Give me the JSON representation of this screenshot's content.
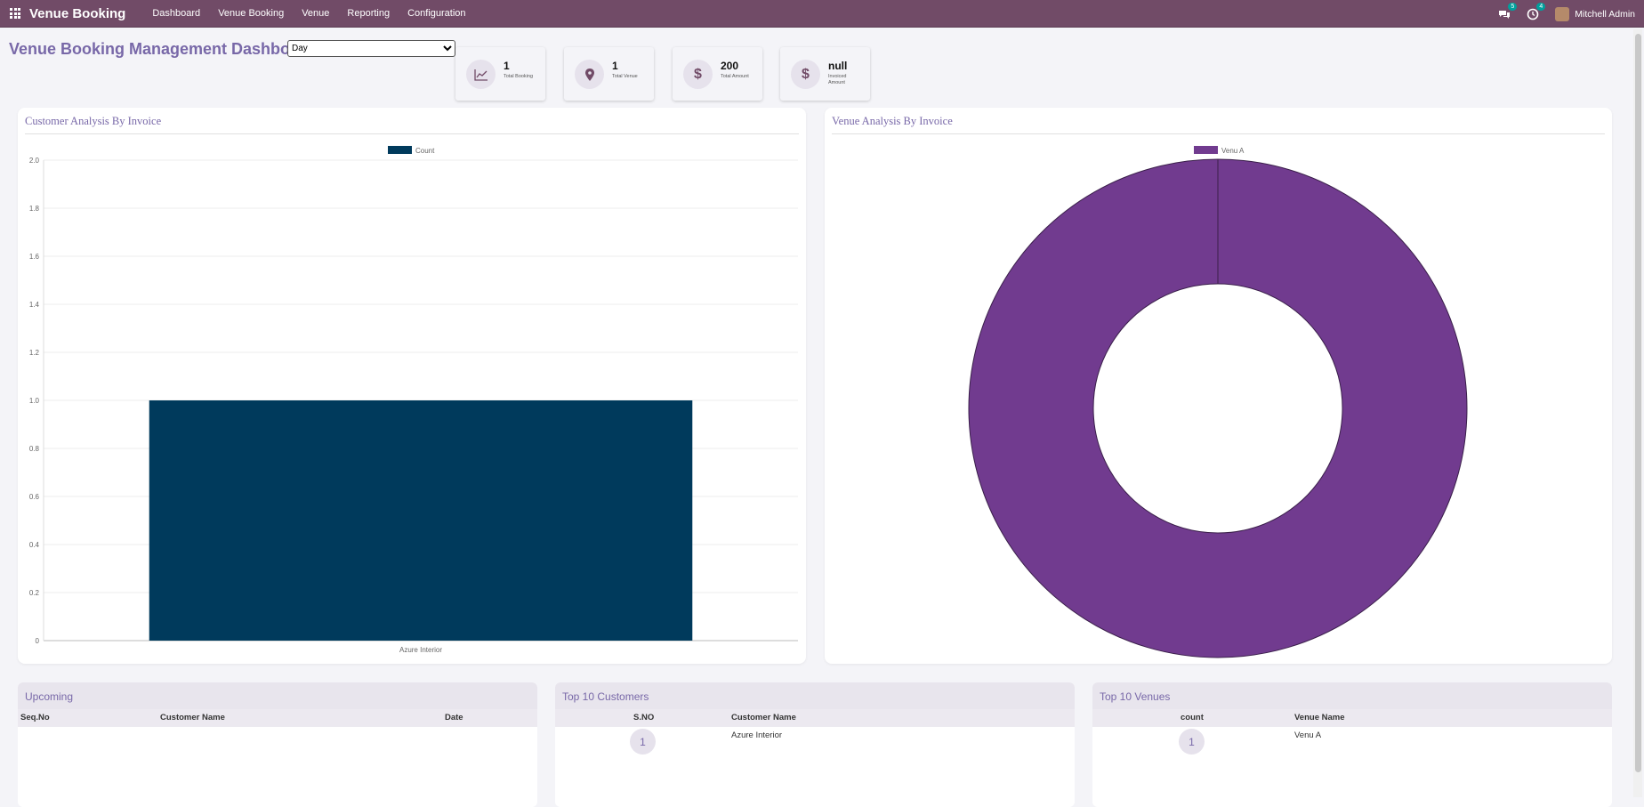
{
  "navbar": {
    "brand": "Venue Booking",
    "menu": [
      "Dashboard",
      "Venue Booking",
      "Venue",
      "Reporting",
      "Configuration"
    ],
    "messages_badge": "5",
    "activities_badge": "4",
    "user_name": "Mitchell Admin"
  },
  "header": {
    "title": "Venue Booking Management Dashboard",
    "period_selected": "Day"
  },
  "kpis": [
    {
      "value": "1",
      "label": "Total Booking",
      "icon": "chart-line-icon"
    },
    {
      "value": "1",
      "label": "Total Venue",
      "icon": "map-marker-icon"
    },
    {
      "value": "200",
      "label": "Total Amount",
      "icon": "dollar-icon"
    },
    {
      "value": "null",
      "label": "Invoiced Amount",
      "icon": "dollar-icon"
    }
  ],
  "bar_card": {
    "title": "Customer Analysis By Invoice"
  },
  "donut_card": {
    "title": "Venue Analysis By Invoice"
  },
  "chart_data": [
    {
      "type": "bar",
      "categories": [
        "Azure Interior"
      ],
      "series": [
        {
          "name": "Count",
          "values": [
            1
          ]
        }
      ],
      "ylim": [
        0,
        2.0
      ],
      "yticks": [
        "0",
        "0.2",
        "0.4",
        "0.6",
        "0.8",
        "1.0",
        "1.2",
        "1.4",
        "1.6",
        "1.8",
        "2.0"
      ],
      "legend": "top-center",
      "color": "#003a5c",
      "grid": true
    },
    {
      "type": "pie",
      "labels": [
        "Venu A"
      ],
      "values": [
        1
      ],
      "legend": "top-center",
      "color": "#713b8f"
    }
  ],
  "tables": {
    "upcoming": {
      "title": "Upcoming",
      "columns": [
        "Seq.No",
        "Customer Name",
        "Date"
      ],
      "rows": []
    },
    "top_customers": {
      "title": "Top 10 Customers",
      "columns": [
        "S.NO",
        "Customer Name"
      ],
      "rows": [
        {
          "sn": "1",
          "name": "Azure Interior"
        }
      ]
    },
    "top_venues": {
      "title": "Top 10 Venues",
      "columns": [
        "count",
        "Venue Name"
      ],
      "rows": [
        {
          "count": "1",
          "name": "Venu A"
        }
      ]
    }
  }
}
